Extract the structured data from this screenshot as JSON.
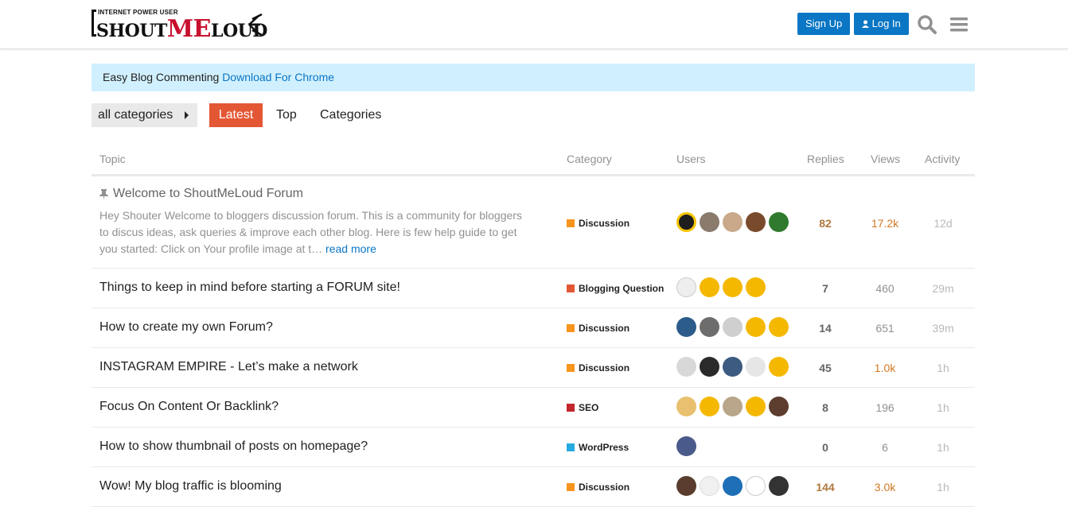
{
  "header": {
    "logo_small": "INTERNET POWER USER",
    "logo_a": "SHOUT",
    "logo_b": "ME",
    "logo_c": "LOUD",
    "signup_label": "Sign Up",
    "login_label": "Log In"
  },
  "banner": {
    "text": "Easy Blog Commenting ",
    "link": "Download For Chrome"
  },
  "nav": {
    "category_select": "all categories",
    "tabs": [
      "Latest",
      "Top",
      "Categories"
    ]
  },
  "columns": [
    "Topic",
    "Category",
    "Users",
    "Replies",
    "Views",
    "Activity"
  ],
  "colors": {
    "discussion": "#f7941d",
    "blogging": "#e45735",
    "seo": "#c1272d",
    "wordpress": "#25aae1"
  },
  "topics": [
    {
      "title": "Welcome to ShoutMeLoud Forum",
      "pinned": true,
      "excerpt": "Hey Shouter Welcome to bloggers discussion forum. This is a community for bloggers to discus ideas, ask queries & improve each other blog. Here is few help guide to get you started: Click on Your profile image at t…",
      "read_more": "read more",
      "category": "Discussion",
      "replies": "82",
      "views": "17.2k",
      "activity": "12d"
    },
    {
      "title": "Things to keep in mind before starting a FORUM site!",
      "category": "Blogging Question",
      "replies": "7",
      "views": "460",
      "activity": "29m"
    },
    {
      "title": "How to create my own Forum?",
      "category": "Discussion",
      "replies": "14",
      "views": "651",
      "activity": "39m"
    },
    {
      "title": "INSTAGRAM EMPIRE - Let’s make a network",
      "category": "Discussion",
      "replies": "45",
      "views": "1.0k",
      "activity": "1h"
    },
    {
      "title": "Focus On Content Or Backlink?",
      "category": "SEO",
      "replies": "8",
      "views": "196",
      "activity": "1h"
    },
    {
      "title": "How to show thumbnail of posts on homepage?",
      "category": "WordPress",
      "replies": "0",
      "views": "6",
      "activity": "1h"
    },
    {
      "title": "Wow! My blog traffic is blooming",
      "category": "Discussion",
      "replies": "144",
      "views": "3.0k",
      "activity": "1h"
    }
  ]
}
